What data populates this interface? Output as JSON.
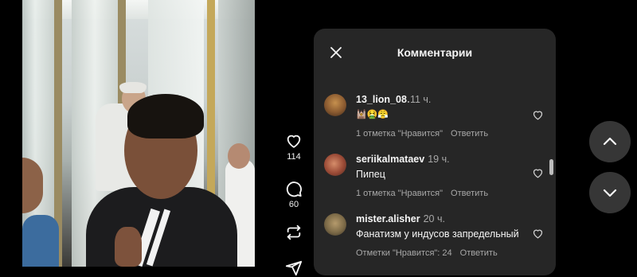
{
  "colors": {
    "panel_bg": "#262626",
    "muted": "#a8a8a8",
    "nav_button_bg": "#363636"
  },
  "actions": {
    "like_count": "114",
    "comment_count": "60"
  },
  "panel": {
    "title": "Комментарии",
    "close_icon": "close-icon"
  },
  "comments": [
    {
      "user": "13_lion_08",
      "time": "11 ч.",
      "text": "🕍🤮😤",
      "likes_label": "1 отметка \"Нравится\"",
      "reply_label": "Ответить",
      "avatar_color": "#7a5a3a"
    },
    {
      "user": "seriikalmataev",
      "time": "19 ч.",
      "text": "Пипец",
      "likes_label": "1 отметка \"Нравится\"",
      "reply_label": "Ответить",
      "avatar_color": "#8d4a3a"
    },
    {
      "user": "mister.alisher",
      "time": "20 ч.",
      "text": "Фанатизм у индусов запредельный",
      "likes_label": "Отметки \"Нравится\": 24",
      "reply_label": "Ответить",
      "avatar_color": "#7d6b48"
    }
  ]
}
